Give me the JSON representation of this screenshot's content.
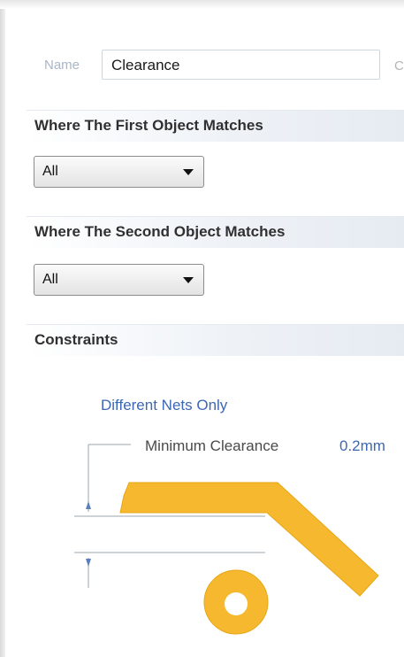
{
  "rule": {
    "name_label": "Name",
    "name_value": "Clearance",
    "name_suffix": "C"
  },
  "first_object": {
    "title": "Where The First Object Matches",
    "selected": "All"
  },
  "second_object": {
    "title": "Where The Second Object Matches",
    "selected": "All"
  },
  "constraints": {
    "title": "Constraints",
    "net_scope": "Different Nets Only",
    "min_clearance_label": "Minimum Clearance",
    "min_clearance_value": "0.2mm"
  },
  "icons": {
    "dropdown": "chevron-down-icon",
    "track": "track-shape",
    "pad": "pad-shape"
  },
  "colors": {
    "copper": "#f5b82e",
    "link_blue": "#3d67b3",
    "label_gray": "#a9b6c8"
  }
}
